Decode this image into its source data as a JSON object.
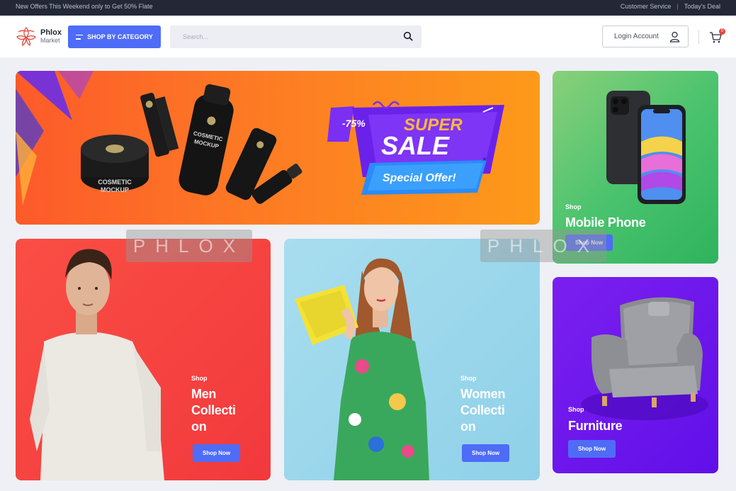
{
  "topbar": {
    "promo": "New Offers This Weekend only to Get 50% Flate",
    "customer_service": "Customer Service",
    "separator": "|",
    "todays_deal": "Today's Deal"
  },
  "header": {
    "logo_name": "Phlox",
    "logo_sub": "Market",
    "category_button": "SHOP BY CATEGORY",
    "search_placeholder": "Search...",
    "login_label": "Login Account",
    "cart_count": "0"
  },
  "hero": {
    "discount": "-75%",
    "headline_1": "SUPER",
    "headline_2": "SALE",
    "offer": "Special Offer!",
    "product_label_1": "COSMETIC",
    "product_label_2": "MOCKUP"
  },
  "cards": {
    "mobile": {
      "kicker": "Shop",
      "title": "Mobile Phone",
      "button": "Shop Now"
    },
    "men": {
      "kicker": "Shop",
      "title_1": "Men",
      "title_2": "Collecti",
      "title_3": "on",
      "button": "Shop Now"
    },
    "women": {
      "kicker": "Shop",
      "title_1": "Women",
      "title_2": "Collecti",
      "title_3": "on",
      "button": "Shop Now"
    },
    "furniture": {
      "kicker": "Shop",
      "title": "Furniture",
      "button": "Shop Now"
    }
  },
  "watermark": {
    "text": "PHLOX"
  },
  "colors": {
    "accent": "#4e6cf7",
    "topbar": "#232836",
    "hero_orange": "#fd7a24",
    "mobile_green": "#4bc36e",
    "men_red": "#f2393d",
    "women_blue": "#8fd1e8",
    "furniture_purple": "#6010e8"
  }
}
